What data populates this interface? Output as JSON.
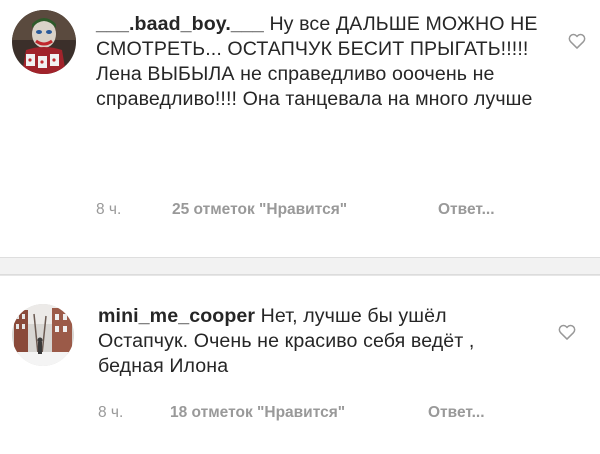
{
  "comments": [
    {
      "username": "___.baad_boy.___",
      "text": "Ну все ДАЛЬШЕ МОЖНО НЕ СМОТРЕТЬ... ОСТАПЧУК БЕСИТ ПРЫГАТЬ!!!!! Лена ВЫБЫЛА не справедливо ооочень не справедливо!!!! Она танцевала на много лучше",
      "time": "8 ч.",
      "likes": "25 отметок \"Нравится\"",
      "reply": "Ответ...",
      "like_icon": "heart-outline-icon",
      "avatar": "joker-avatar"
    },
    {
      "username": "mini_me_cooper",
      "text": "Нет, лучше бы ушёл Остапчук. Очень не красиво себя ведёт , бедная Илона",
      "time": "8 ч.",
      "likes": "18 отметок \"Нравится\"",
      "reply": "Ответ...",
      "like_icon": "heart-outline-icon",
      "avatar": "winter-street-avatar"
    }
  ],
  "colors": {
    "text": "#262626",
    "meta": "#999999",
    "separator": "#f2f2f2"
  }
}
